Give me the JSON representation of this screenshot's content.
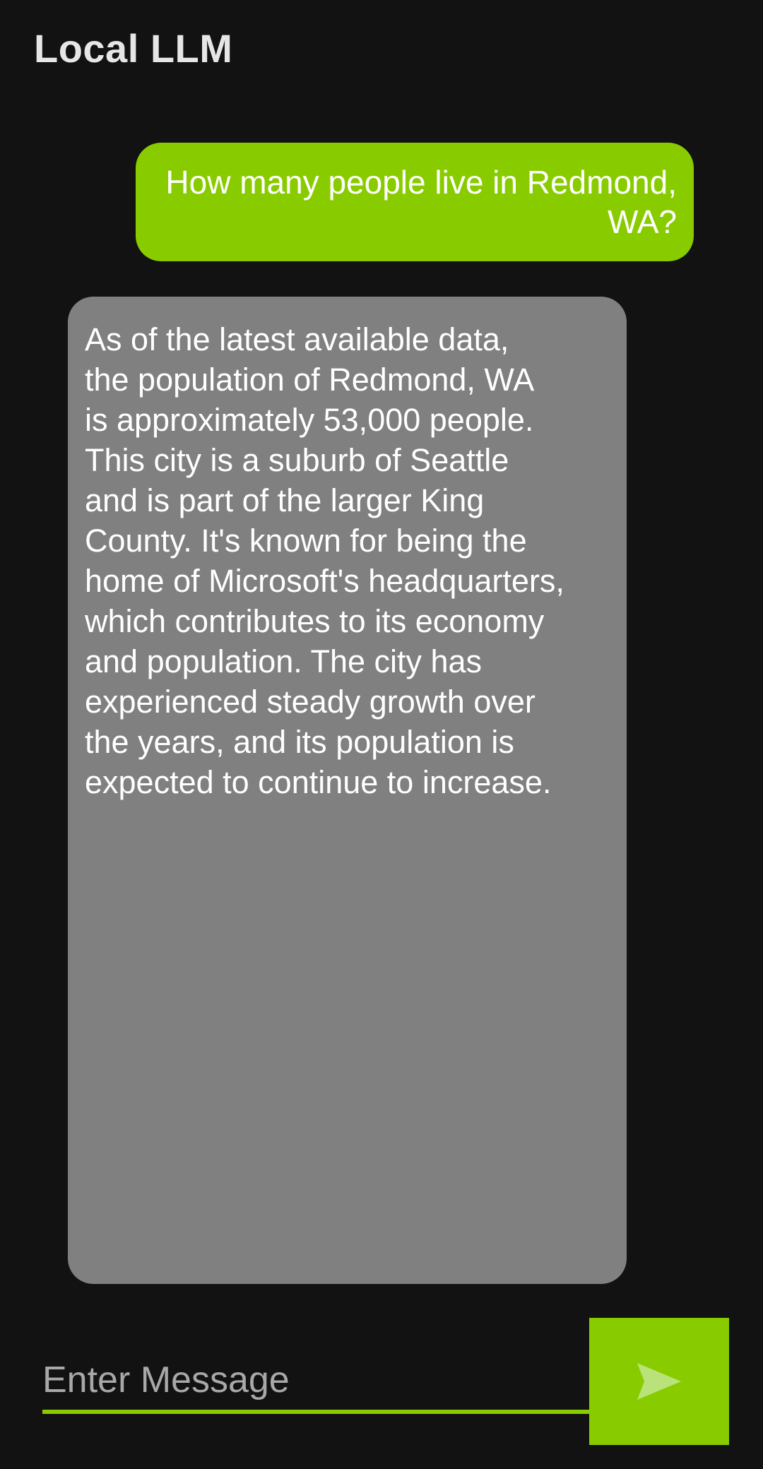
{
  "app": {
    "title": "Local LLM"
  },
  "conversation": {
    "user_message": "How many people live in Redmond, WA?",
    "assistant_message_lines": [
      "As of the latest available data,",
      "the population of Redmond, WA",
      "is approximately 53,000 people.",
      "This city is a suburb of Seattle",
      "and is part of the larger King",
      "County. It's known for being the",
      "home of Microsoft's headquarters,",
      "which contributes to its economy",
      "and population. The city has",
      "experienced steady growth over",
      "the years, and its population is",
      "expected to continue to increase."
    ]
  },
  "composer": {
    "placeholder": "Enter Message",
    "value": "",
    "send_icon": "send-icon"
  },
  "colors": {
    "background": "#121212",
    "accent": "#88cc00",
    "assistant_bubble": "#808080",
    "title_text": "#e6e6e6"
  }
}
